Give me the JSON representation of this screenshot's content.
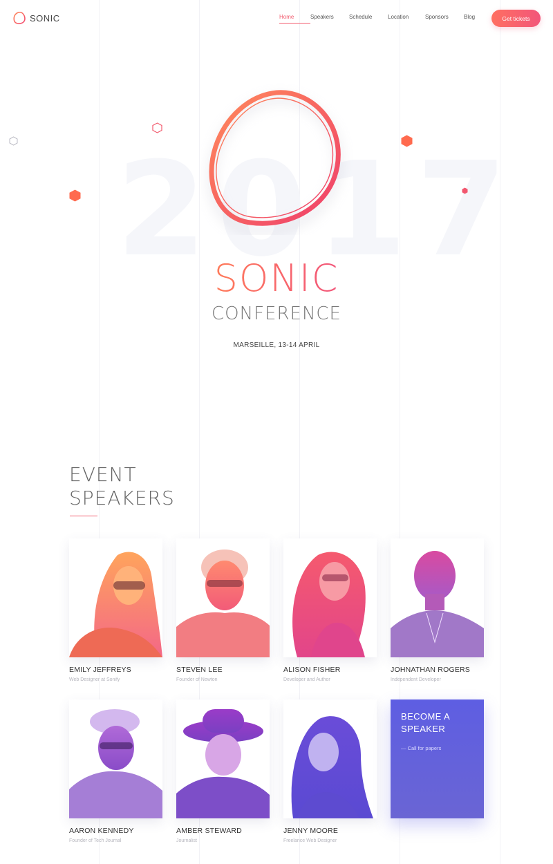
{
  "header": {
    "logo_text": "SONIC",
    "nav": [
      {
        "label": "Home",
        "active": true
      },
      {
        "label": "Speakers",
        "active": false
      },
      {
        "label": "Schedule",
        "active": false
      },
      {
        "label": "Location",
        "active": false
      },
      {
        "label": "Sponsors",
        "active": false
      },
      {
        "label": "Blog",
        "active": false
      }
    ],
    "cta_label": "Get tickets"
  },
  "hero": {
    "year": "2017",
    "title": "SONIC",
    "subtitle": "CONFERENCE",
    "date": "MARSEILLE, 13-14 APRIL"
  },
  "speakers_section": {
    "title_line1": "EVENT",
    "title_line2": "SPEAKERS",
    "speakers": [
      {
        "name": "EMILY JEFFREYS",
        "role": "Web Designer at Sonify"
      },
      {
        "name": "STEVEN LEE",
        "role": "Founder of Newton"
      },
      {
        "name": "ALISON FISHER",
        "role": "Developer and Author"
      },
      {
        "name": "JOHNATHAN ROGERS",
        "role": "Independent Developer"
      },
      {
        "name": "AARON KENNEDY",
        "role": "Founder of Tech Journal"
      },
      {
        "name": "AMBER STEWARD",
        "role": "Journalist"
      },
      {
        "name": "JENNY MOORE",
        "role": "Freelance Web Designer"
      }
    ],
    "become_speaker": {
      "title": "BECOME A SPEAKER",
      "link": "— Call for papers"
    }
  },
  "colors": {
    "accent": "#f25b6e",
    "accent_orange": "#ff7b5a",
    "purple": "#5e5ee2"
  }
}
